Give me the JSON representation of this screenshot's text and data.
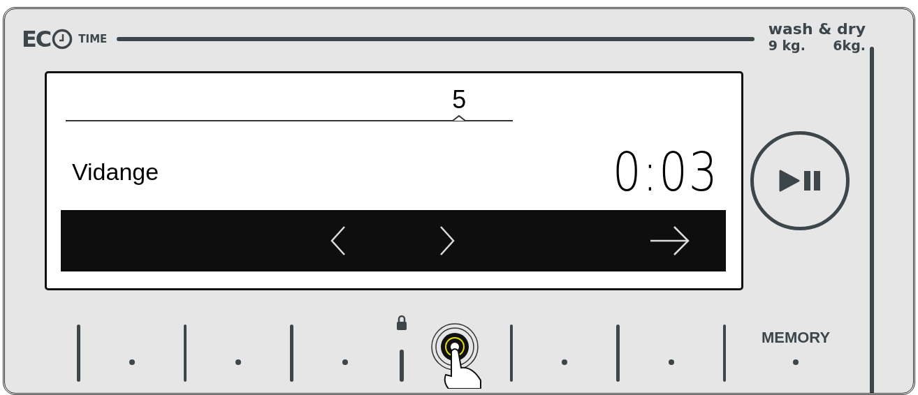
{
  "logo": {
    "eco": "EC",
    "time": "TIME"
  },
  "brand": {
    "title": "wash & dry",
    "capacities": [
      "9 kg.",
      "6kg."
    ]
  },
  "display": {
    "slider": {
      "value": "5",
      "level": 0.88
    },
    "program": "Vidange",
    "time": "0:03"
  },
  "keys": [
    {
      "kind": "dot",
      "lock": false
    },
    {
      "kind": "dot",
      "lock": false
    },
    {
      "kind": "dot",
      "lock": false
    },
    {
      "kind": "pressed",
      "lock": true
    },
    {
      "kind": "dot",
      "lock": false
    },
    {
      "kind": "dot",
      "lock": false
    },
    {
      "kind": "dot",
      "lock": false,
      "label": "MEMORY"
    }
  ]
}
